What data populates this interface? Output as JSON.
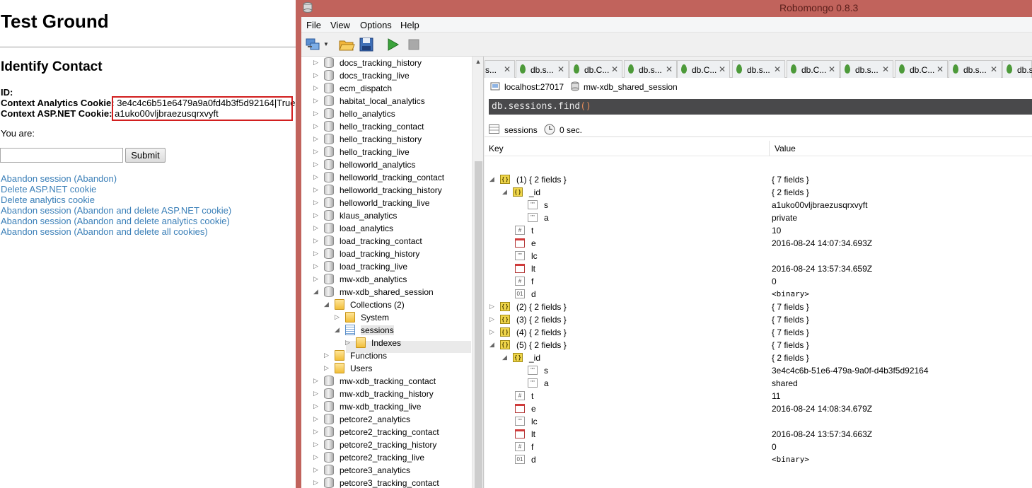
{
  "webpage": {
    "title": "Test Ground",
    "section_title": "Identify Contact",
    "id_label": "ID:",
    "analytics_cookie_label": "Context Analytics Cookie:",
    "analytics_cookie_value": "3e4c4c6b51e6479a9a0fd4b3f5d92164|True",
    "aspnet_cookie_label": "Context ASP.NET Cookie:",
    "aspnet_cookie_value": "a1uko00vljbraezusqrxvyft",
    "you_are_label": "You are:",
    "name_input_value": "",
    "submit_label": "Submit",
    "links": [
      "Abandon session (Abandon)",
      "Delete ASP.NET cookie",
      "Delete analytics cookie",
      "Abandon session (Abandon and delete ASP.NET cookie)",
      "Abandon session (Abandon and delete analytics cookie)",
      "Abandon session (Abandon and delete all cookies)"
    ],
    "highlight_color": "#d21f1f"
  },
  "robomongo": {
    "window_title": "Robomongo 0.8.3",
    "menu": [
      "File",
      "View",
      "Options",
      "Help"
    ],
    "toolbar_icons": [
      "connect-icon",
      "open-icon",
      "save-icon",
      "execute-icon",
      "stop-icon"
    ],
    "tree": [
      {
        "label": "docs_tracking_history",
        "type": "db",
        "expand": "collapsed"
      },
      {
        "label": "docs_tracking_live",
        "type": "db",
        "expand": "collapsed"
      },
      {
        "label": "ecm_dispatch",
        "type": "db",
        "expand": "collapsed"
      },
      {
        "label": "habitat_local_analytics",
        "type": "db",
        "expand": "collapsed"
      },
      {
        "label": "hello_analytics",
        "type": "db",
        "expand": "collapsed"
      },
      {
        "label": "hello_tracking_contact",
        "type": "db",
        "expand": "collapsed"
      },
      {
        "label": "hello_tracking_history",
        "type": "db",
        "expand": "collapsed"
      },
      {
        "label": "hello_tracking_live",
        "type": "db",
        "expand": "collapsed"
      },
      {
        "label": "helloworld_analytics",
        "type": "db",
        "expand": "collapsed"
      },
      {
        "label": "helloworld_tracking_contact",
        "type": "db",
        "expand": "collapsed"
      },
      {
        "label": "helloworld_tracking_history",
        "type": "db",
        "expand": "collapsed"
      },
      {
        "label": "helloworld_tracking_live",
        "type": "db",
        "expand": "collapsed"
      },
      {
        "label": "klaus_analytics",
        "type": "db",
        "expand": "collapsed"
      },
      {
        "label": "load_analytics",
        "type": "db",
        "expand": "collapsed"
      },
      {
        "label": "load_tracking_contact",
        "type": "db",
        "expand": "collapsed"
      },
      {
        "label": "load_tracking_history",
        "type": "db",
        "expand": "collapsed"
      },
      {
        "label": "load_tracking_live",
        "type": "db",
        "expand": "collapsed"
      },
      {
        "label": "mw-xdb_analytics",
        "type": "db",
        "expand": "collapsed"
      },
      {
        "label": "mw-xdb_shared_session",
        "type": "db",
        "expand": "expanded"
      },
      {
        "label": "Collections (2)",
        "type": "folder",
        "expand": "expanded",
        "level": 1
      },
      {
        "label": "System",
        "type": "folder",
        "expand": "collapsed",
        "level": 2
      },
      {
        "label": "sessions",
        "type": "collection",
        "expand": "expanded",
        "level": 2,
        "selected": true
      },
      {
        "label": "Indexes",
        "type": "folder",
        "expand": "collapsed",
        "level": 3
      },
      {
        "label": "Functions",
        "type": "folder",
        "expand": "collapsed",
        "level": 1
      },
      {
        "label": "Users",
        "type": "folder",
        "expand": "collapsed",
        "level": 1
      },
      {
        "label": "mw-xdb_tracking_contact",
        "type": "db",
        "expand": "collapsed"
      },
      {
        "label": "mw-xdb_tracking_history",
        "type": "db",
        "expand": "collapsed"
      },
      {
        "label": "mw-xdb_tracking_live",
        "type": "db",
        "expand": "collapsed"
      },
      {
        "label": "petcore2_analytics",
        "type": "db",
        "expand": "collapsed"
      },
      {
        "label": "petcore2_tracking_contact",
        "type": "db",
        "expand": "collapsed"
      },
      {
        "label": "petcore2_tracking_history",
        "type": "db",
        "expand": "collapsed"
      },
      {
        "label": "petcore2_tracking_live",
        "type": "db",
        "expand": "collapsed"
      },
      {
        "label": "petcore3_analytics",
        "type": "db",
        "expand": "collapsed"
      },
      {
        "label": "petcore3_tracking_contact",
        "type": "db",
        "expand": "collapsed"
      }
    ],
    "tabs": [
      {
        "label": "s...",
        "leaf": false
      },
      {
        "label": "db.s...",
        "leaf": true
      },
      {
        "label": "db.C...",
        "leaf": true
      },
      {
        "label": "db.s...",
        "leaf": true
      },
      {
        "label": "db.C...",
        "leaf": true
      },
      {
        "label": "db.s...",
        "leaf": true
      },
      {
        "label": "db.C...",
        "leaf": true
      },
      {
        "label": "db.s...",
        "leaf": true
      },
      {
        "label": "db.C...",
        "leaf": true
      },
      {
        "label": "db.s...",
        "leaf": true
      },
      {
        "label": "db.s...",
        "leaf": true
      }
    ],
    "tab_close": "✕",
    "connection": "localhost:27017",
    "database": "mw-xdb_shared_session",
    "query_prefix": "db.sessions.find",
    "query_parens": "()",
    "result_collection": "sessions",
    "result_time": "0 sec.",
    "grid_headers": {
      "key": "Key",
      "value": "Value"
    },
    "documents": [
      {
        "key": "(1) { 2 fields }",
        "value": "{ 7 fields }",
        "icon": "obj",
        "depth": 0,
        "expand": "expanded"
      },
      {
        "key": "_id",
        "value": "{ 2 fields }",
        "icon": "obj",
        "depth": 1,
        "expand": "expanded"
      },
      {
        "key": "s",
        "value": "a1uko00vljbraezusqrxvyft",
        "icon": "str",
        "depth": 2,
        "expand": "none"
      },
      {
        "key": "a",
        "value": "private",
        "icon": "str",
        "depth": 2,
        "expand": "none"
      },
      {
        "key": "t",
        "value": "10",
        "icon": "num",
        "depth": 1,
        "expand": "none"
      },
      {
        "key": "e",
        "value": "2016-08-24 14:07:34.693Z",
        "icon": "date",
        "depth": 1,
        "expand": "none"
      },
      {
        "key": "lc",
        "value": "",
        "icon": "str",
        "depth": 1,
        "expand": "none"
      },
      {
        "key": "lt",
        "value": "2016-08-24 13:57:34.659Z",
        "icon": "date",
        "depth": 1,
        "expand": "none"
      },
      {
        "key": "f",
        "value": "0",
        "icon": "num",
        "depth": 1,
        "expand": "none"
      },
      {
        "key": "d",
        "value": "<binary>",
        "icon": "bin",
        "depth": 1,
        "expand": "none"
      },
      {
        "key": "(2) { 2 fields }",
        "value": "{ 7 fields }",
        "icon": "obj",
        "depth": 0,
        "expand": "collapsed"
      },
      {
        "key": "(3) { 2 fields }",
        "value": "{ 7 fields }",
        "icon": "obj",
        "depth": 0,
        "expand": "collapsed"
      },
      {
        "key": "(4) { 2 fields }",
        "value": "{ 7 fields }",
        "icon": "obj",
        "depth": 0,
        "expand": "collapsed"
      },
      {
        "key": "(5) { 2 fields }",
        "value": "{ 7 fields }",
        "icon": "obj",
        "depth": 0,
        "expand": "expanded"
      },
      {
        "key": "_id",
        "value": "{ 2 fields }",
        "icon": "obj",
        "depth": 1,
        "expand": "expanded"
      },
      {
        "key": "s",
        "value": "3e4c4c6b-51e6-479a-9a0f-d4b3f5d92164",
        "icon": "str",
        "depth": 2,
        "expand": "none"
      },
      {
        "key": "a",
        "value": "shared",
        "icon": "str",
        "depth": 2,
        "expand": "none"
      },
      {
        "key": "t",
        "value": "11",
        "icon": "num",
        "depth": 1,
        "expand": "none"
      },
      {
        "key": "e",
        "value": "2016-08-24 14:08:34.679Z",
        "icon": "date",
        "depth": 1,
        "expand": "none"
      },
      {
        "key": "lc",
        "value": "",
        "icon": "str",
        "depth": 1,
        "expand": "none"
      },
      {
        "key": "lt",
        "value": "2016-08-24 13:57:34.663Z",
        "icon": "date",
        "depth": 1,
        "expand": "none"
      },
      {
        "key": "f",
        "value": "0",
        "icon": "num",
        "depth": 1,
        "expand": "none"
      },
      {
        "key": "d",
        "value": "<binary>",
        "icon": "bin",
        "depth": 1,
        "expand": "none"
      }
    ],
    "title_bar_color": "#c1635c"
  }
}
